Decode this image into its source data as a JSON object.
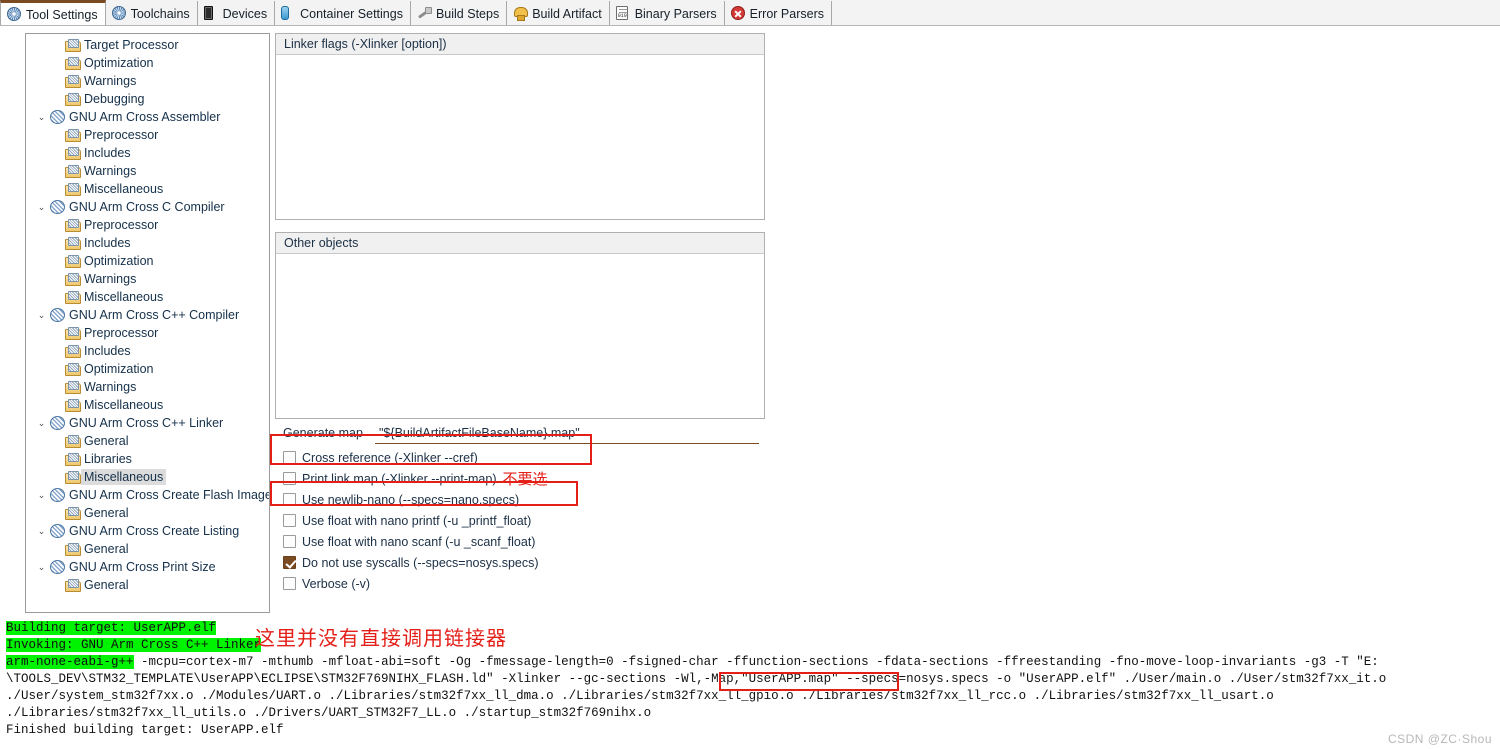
{
  "tabs": [
    {
      "label": "Tool Settings",
      "icon": "gear-icon",
      "active": true
    },
    {
      "label": "Toolchains",
      "icon": "gear-icon",
      "active": false
    },
    {
      "label": "Devices",
      "icon": "device-chip-icon",
      "active": false
    },
    {
      "label": "Container Settings",
      "icon": "container-icon",
      "active": false
    },
    {
      "label": "Build Steps",
      "icon": "build-steps-icon",
      "active": false
    },
    {
      "label": "Build Artifact",
      "icon": "build-artifact-icon",
      "active": false
    },
    {
      "label": "Binary Parsers",
      "icon": "binary-parser-icon",
      "active": false
    },
    {
      "label": "Error Parsers",
      "icon": "error-parser-icon",
      "active": false
    }
  ],
  "tree": [
    {
      "label": "Target Processor",
      "level": 2,
      "icon": "folder-icon",
      "arrow": "",
      "selected": false
    },
    {
      "label": "Optimization",
      "level": 2,
      "icon": "folder-icon",
      "arrow": "",
      "selected": false
    },
    {
      "label": "Warnings",
      "level": 2,
      "icon": "folder-icon",
      "arrow": "",
      "selected": false
    },
    {
      "label": "Debugging",
      "level": 2,
      "icon": "folder-icon",
      "arrow": "",
      "selected": false
    },
    {
      "label": "GNU Arm Cross Assembler",
      "level": 1,
      "icon": "globe-icon",
      "arrow": "⌄",
      "selected": false
    },
    {
      "label": "Preprocessor",
      "level": 2,
      "icon": "folder-icon",
      "arrow": "",
      "selected": false
    },
    {
      "label": "Includes",
      "level": 2,
      "icon": "folder-icon",
      "arrow": "",
      "selected": false
    },
    {
      "label": "Warnings",
      "level": 2,
      "icon": "folder-icon",
      "arrow": "",
      "selected": false
    },
    {
      "label": "Miscellaneous",
      "level": 2,
      "icon": "folder-icon",
      "arrow": "",
      "selected": false
    },
    {
      "label": "GNU Arm Cross C Compiler",
      "level": 1,
      "icon": "globe-icon",
      "arrow": "⌄",
      "selected": false
    },
    {
      "label": "Preprocessor",
      "level": 2,
      "icon": "folder-icon",
      "arrow": "",
      "selected": false
    },
    {
      "label": "Includes",
      "level": 2,
      "icon": "folder-icon",
      "arrow": "",
      "selected": false
    },
    {
      "label": "Optimization",
      "level": 2,
      "icon": "folder-icon",
      "arrow": "",
      "selected": false
    },
    {
      "label": "Warnings",
      "level": 2,
      "icon": "folder-icon",
      "arrow": "",
      "selected": false
    },
    {
      "label": "Miscellaneous",
      "level": 2,
      "icon": "folder-icon",
      "arrow": "",
      "selected": false
    },
    {
      "label": "GNU Arm Cross C++ Compiler",
      "level": 1,
      "icon": "globe-icon",
      "arrow": "⌄",
      "selected": false
    },
    {
      "label": "Preprocessor",
      "level": 2,
      "icon": "folder-icon",
      "arrow": "",
      "selected": false
    },
    {
      "label": "Includes",
      "level": 2,
      "icon": "folder-icon",
      "arrow": "",
      "selected": false
    },
    {
      "label": "Optimization",
      "level": 2,
      "icon": "folder-icon",
      "arrow": "",
      "selected": false
    },
    {
      "label": "Warnings",
      "level": 2,
      "icon": "folder-icon",
      "arrow": "",
      "selected": false
    },
    {
      "label": "Miscellaneous",
      "level": 2,
      "icon": "folder-icon",
      "arrow": "",
      "selected": false
    },
    {
      "label": "GNU Arm Cross C++ Linker",
      "level": 1,
      "icon": "globe-icon",
      "arrow": "⌄",
      "selected": false
    },
    {
      "label": "General",
      "level": 2,
      "icon": "folder-icon",
      "arrow": "",
      "selected": false
    },
    {
      "label": "Libraries",
      "level": 2,
      "icon": "folder-icon",
      "arrow": "",
      "selected": false
    },
    {
      "label": "Miscellaneous",
      "level": 2,
      "icon": "folder-icon",
      "arrow": "",
      "selected": true
    },
    {
      "label": "GNU Arm Cross Create Flash Image",
      "level": 1,
      "icon": "globe-icon",
      "arrow": "⌄",
      "selected": false
    },
    {
      "label": "General",
      "level": 2,
      "icon": "folder-icon",
      "arrow": "",
      "selected": false
    },
    {
      "label": "GNU Arm Cross Create Listing",
      "level": 1,
      "icon": "globe-icon",
      "arrow": "⌄",
      "selected": false
    },
    {
      "label": "General",
      "level": 2,
      "icon": "folder-icon",
      "arrow": "",
      "selected": false
    },
    {
      "label": "GNU Arm Cross Print Size",
      "level": 1,
      "icon": "globe-icon",
      "arrow": "⌄",
      "selected": false
    },
    {
      "label": "General",
      "level": 2,
      "icon": "folder-icon",
      "arrow": "",
      "selected": false
    }
  ],
  "pane": {
    "linker_flags_header": "Linker flags (-Xlinker [option])",
    "other_objects_header": "Other objects",
    "generate_map_label": "Generate map",
    "generate_map_value": "\"${BuildArtifactFileBaseName}.map\"",
    "generate_map_placeholder": ""
  },
  "checkboxes": [
    {
      "label": "Cross reference (-Xlinker --cref)",
      "checked": false,
      "note": ""
    },
    {
      "label": "Print link map (-Xlinker --print-map)",
      "checked": false,
      "note": "不要选"
    },
    {
      "label": "Use newlib-nano (--specs=nano.specs)",
      "checked": false,
      "note": ""
    },
    {
      "label": "Use float with nano printf (-u _printf_float)",
      "checked": false,
      "note": ""
    },
    {
      "label": "Use float with nano scanf (-u _scanf_float)",
      "checked": false,
      "note": ""
    },
    {
      "label": "Do not use syscalls (--specs=nosys.specs)",
      "checked": true,
      "note": ""
    },
    {
      "label": "Verbose (-v)",
      "checked": false,
      "note": ""
    }
  ],
  "console": {
    "line1_green": "Building target: UserAPP.elf",
    "line2_green": "Invoking: GNU Arm Cross C++ Linker",
    "line3_green": "arm-none-eabi-g++",
    "line3_rest": " -mcpu=cortex-m7 -mthumb -mfloat-abi=soft -Og -fmessage-length=0 -fsigned-char -ffunction-sections -fdata-sections -ffreestanding -fno-move-loop-invariants -g3 -T \"E:",
    "line4_a": "\\TOOLS_DEV\\STM32_TEMPLATE\\UserAPP\\ECLIPSE\\STM32F769NIHX_FLASH.ld\" -Xlinker --gc-sections ",
    "line4_boxed": "-Wl,-Map,\"UserAPP.map\"",
    "line4_b": " --specs=nosys.specs -o \"UserAPP.elf\" ./User/main.o ./User/stm32f7xx_it.o",
    "line5": "./User/system_stm32f7xx.o  ./Modules/UART.o  ./Libraries/stm32f7xx_ll_dma.o ./Libraries/stm32f7xx_ll_gpio.o ./Libraries/stm32f7xx_ll_rcc.o ./Libraries/stm32f7xx_ll_usart.o",
    "line6": "./Libraries/stm32f7xx_ll_utils.o  ./Drivers/UART_STM32F7_LL.o  ./startup_stm32f769nihx.o",
    "line7": "Finished building target: UserAPP.elf",
    "annotation_cn": "这里并没有直接调用链接器"
  },
  "watermark": "CSDN @ZC·Shou",
  "colors": {
    "accent_brown": "#7a4a21",
    "highlight_red": "#e41f18",
    "highlight_green": "#00f300",
    "tree_text": "#15304a"
  }
}
